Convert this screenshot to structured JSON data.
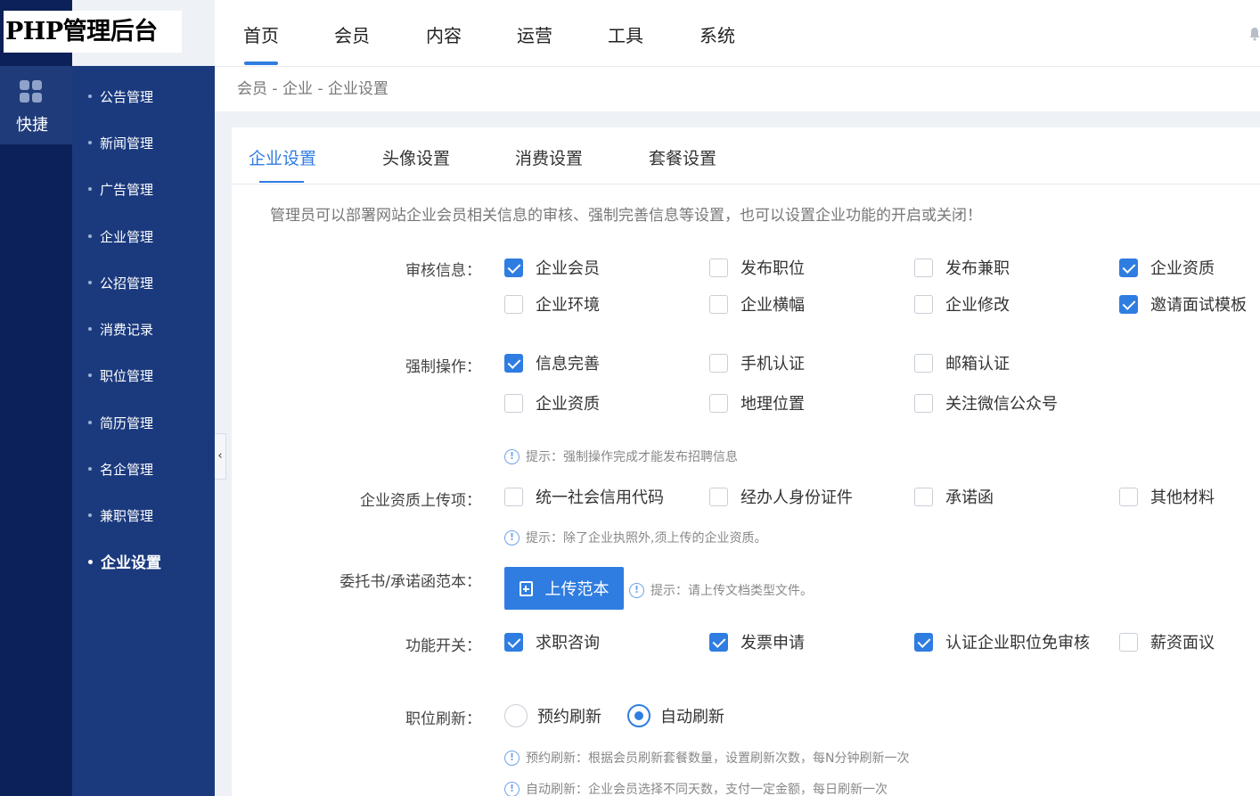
{
  "app": {
    "logo_text": "PHP管理后台"
  },
  "rail": {
    "quick_label": "快捷"
  },
  "subnav": {
    "items": [
      "公告管理",
      "新闻管理",
      "广告管理",
      "企业管理",
      "公招管理",
      "消费记录",
      "职位管理",
      "简历管理",
      "名企管理",
      "兼职管理",
      "企业设置"
    ],
    "active": "企业设置"
  },
  "topnav": {
    "items": [
      "首页",
      "会员",
      "内容",
      "运营",
      "工具",
      "系统"
    ],
    "active": "首页"
  },
  "breadcrumb": "会员 - 企业 - 企业设置",
  "tabs": {
    "items": [
      "企业设置",
      "头像设置",
      "消费设置",
      "套餐设置"
    ],
    "active": "企业设置"
  },
  "intro": "管理员可以部署网站企业会员相关信息的审核、强制完善信息等设置，也可以设置企业功能的开启或关闭！",
  "audit": {
    "label": "审核信息：",
    "options": [
      {
        "label": "企业会员",
        "checked": true
      },
      {
        "label": "发布职位",
        "checked": false
      },
      {
        "label": "发布兼职",
        "checked": false
      },
      {
        "label": "企业资质",
        "checked": true
      },
      {
        "label": "企业环境",
        "checked": false
      },
      {
        "label": "企业横幅",
        "checked": false
      },
      {
        "label": "企业修改",
        "checked": false
      },
      {
        "label": "邀请面试模板",
        "checked": true
      }
    ]
  },
  "force": {
    "label": "强制操作：",
    "options": [
      {
        "label": "信息完善",
        "checked": true
      },
      {
        "label": "手机认证",
        "checked": false
      },
      {
        "label": "邮箱认证",
        "checked": false
      },
      {
        "label": "企业资质",
        "checked": false
      },
      {
        "label": "地理位置",
        "checked": false
      },
      {
        "label": "关注微信公众号",
        "checked": false
      }
    ],
    "hint": "提示：强制操作完成才能发布招聘信息"
  },
  "qualification": {
    "label": "企业资质上传项：",
    "options": [
      {
        "label": "统一社会信用代码",
        "checked": false
      },
      {
        "label": "经办人身份证件",
        "checked": false
      },
      {
        "label": "承诺函",
        "checked": false
      },
      {
        "label": "其他材料",
        "checked": false
      }
    ],
    "hint": "提示：除了企业执照外,须上传的企业资质。"
  },
  "template": {
    "label": "委托书/承诺函范本：",
    "button": "上传范本",
    "hint": "提示：请上传文档类型文件。"
  },
  "features": {
    "label": "功能开关：",
    "options": [
      {
        "label": "求职咨询",
        "checked": true
      },
      {
        "label": "发票申请",
        "checked": true
      },
      {
        "label": "认证企业职位免审核",
        "checked": true
      },
      {
        "label": "薪资面议",
        "checked": false
      }
    ]
  },
  "refresh": {
    "label": "职位刷新：",
    "options": [
      {
        "label": "预约刷新",
        "selected": false
      },
      {
        "label": "自动刷新",
        "selected": true
      }
    ],
    "hint1": "预约刷新：根据会员刷新套餐数量，设置刷新次数，每N分钟刷新一次",
    "hint2": "自动刷新：企业会员选择不同天数，支付一定金额，每日刷新一次"
  },
  "colors": {
    "accent": "#2f7de1",
    "sidebar": "#1b3a7e",
    "rail": "#0c2157"
  }
}
